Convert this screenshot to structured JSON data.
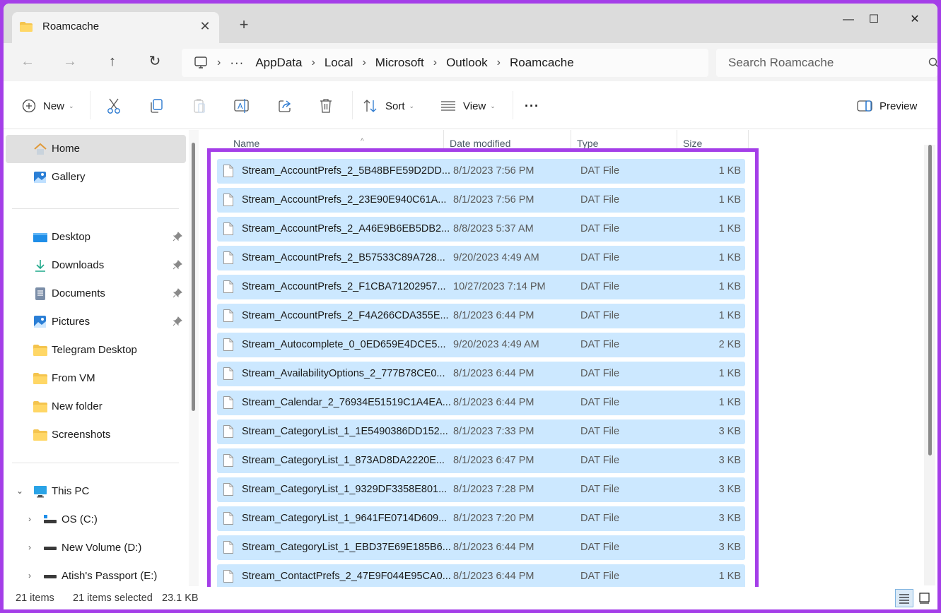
{
  "window": {
    "tab_title": "Roamcache",
    "tab_close_icon": "close-icon",
    "new_tab_icon": "plus-icon",
    "controls": {
      "minimize": "—",
      "maximize": "☐",
      "close": "✕"
    }
  },
  "nav": {
    "back": "←",
    "forward": "→",
    "up": "↑",
    "refresh": "↻"
  },
  "address": {
    "more": "···",
    "separator": "›",
    "crumbs": [
      "AppData",
      "Local",
      "Microsoft",
      "Outlook",
      "Roamcache"
    ]
  },
  "search": {
    "placeholder": "Search Roamcache",
    "value": ""
  },
  "toolbar": {
    "new_label": "New",
    "sort_label": "Sort",
    "view_label": "View",
    "more_label": "···",
    "preview_label": "Preview",
    "icons": [
      "plus-circle-icon",
      "cut-icon",
      "copy-icon",
      "paste-icon",
      "rename-icon",
      "share-icon",
      "delete-icon",
      "sort-icon",
      "view-icon",
      "more-icon",
      "preview-pane-icon"
    ]
  },
  "sidebar": {
    "quick": [
      {
        "label": "Home",
        "icon": "home-icon",
        "selected": true
      },
      {
        "label": "Gallery",
        "icon": "gallery-icon"
      }
    ],
    "pinned": [
      {
        "label": "Desktop",
        "icon": "desktop-folder-icon",
        "pinned": true
      },
      {
        "label": "Downloads",
        "icon": "downloads-icon",
        "pinned": true
      },
      {
        "label": "Documents",
        "icon": "documents-icon",
        "pinned": true
      },
      {
        "label": "Pictures",
        "icon": "pictures-icon",
        "pinned": true
      },
      {
        "label": "Telegram Desktop",
        "icon": "folder-icon"
      },
      {
        "label": "From VM",
        "icon": "folder-icon"
      },
      {
        "label": "New folder",
        "icon": "folder-icon"
      },
      {
        "label": "Screenshots",
        "icon": "folder-icon"
      }
    ],
    "this_pc": {
      "label": "This PC",
      "expanded": true
    },
    "drives": [
      {
        "label": "OS (C:)"
      },
      {
        "label": "New Volume (D:)"
      },
      {
        "label": "Atish's Passport  (E:)"
      }
    ]
  },
  "columns": {
    "name": "Name",
    "date": "Date modified",
    "type": "Type",
    "size": "Size"
  },
  "files": [
    {
      "name": "Stream_AccountPrefs_2_5B48BFE59D2DD...",
      "date": "8/1/2023 7:56 PM",
      "type": "DAT File",
      "size": "1 KB"
    },
    {
      "name": "Stream_AccountPrefs_2_23E90E940C61A...",
      "date": "8/1/2023 7:56 PM",
      "type": "DAT File",
      "size": "1 KB"
    },
    {
      "name": "Stream_AccountPrefs_2_A46E9B6EB5DB2...",
      "date": "8/8/2023 5:37 AM",
      "type": "DAT File",
      "size": "1 KB"
    },
    {
      "name": "Stream_AccountPrefs_2_B57533C89A728...",
      "date": "9/20/2023 4:49 AM",
      "type": "DAT File",
      "size": "1 KB"
    },
    {
      "name": "Stream_AccountPrefs_2_F1CBA71202957...",
      "date": "10/27/2023 7:14 PM",
      "type": "DAT File",
      "size": "1 KB"
    },
    {
      "name": "Stream_AccountPrefs_2_F4A266CDA355E...",
      "date": "8/1/2023 6:44 PM",
      "type": "DAT File",
      "size": "1 KB"
    },
    {
      "name": "Stream_Autocomplete_0_0ED659E4DCE5...",
      "date": "9/20/2023 4:49 AM",
      "type": "DAT File",
      "size": "2 KB"
    },
    {
      "name": "Stream_AvailabilityOptions_2_777B78CE0...",
      "date": "8/1/2023 6:44 PM",
      "type": "DAT File",
      "size": "1 KB"
    },
    {
      "name": "Stream_Calendar_2_76934E51519C1A4EA...",
      "date": "8/1/2023 6:44 PM",
      "type": "DAT File",
      "size": "1 KB"
    },
    {
      "name": "Stream_CategoryList_1_1E5490386DD152...",
      "date": "8/1/2023 7:33 PM",
      "type": "DAT File",
      "size": "3 KB"
    },
    {
      "name": "Stream_CategoryList_1_873AD8DA2220E...",
      "date": "8/1/2023 6:47 PM",
      "type": "DAT File",
      "size": "3 KB"
    },
    {
      "name": "Stream_CategoryList_1_9329DF3358E801...",
      "date": "8/1/2023 7:28 PM",
      "type": "DAT File",
      "size": "3 KB"
    },
    {
      "name": "Stream_CategoryList_1_9641FE0714D609...",
      "date": "8/1/2023 7:20 PM",
      "type": "DAT File",
      "size": "3 KB"
    },
    {
      "name": "Stream_CategoryList_1_EBD37E69E185B6...",
      "date": "8/1/2023 6:44 PM",
      "type": "DAT File",
      "size": "3 KB"
    },
    {
      "name": "Stream_ContactPrefs_2_47E9F044E95CA0...",
      "date": "8/1/2023 6:44 PM",
      "type": "DAT File",
      "size": "1 KB"
    }
  ],
  "status": {
    "item_count": "21 items",
    "selection": "21 items selected",
    "selection_size": "23.1 KB"
  },
  "colors": {
    "highlight_border": "#a43ee8",
    "selected_row": "#cce8ff"
  }
}
